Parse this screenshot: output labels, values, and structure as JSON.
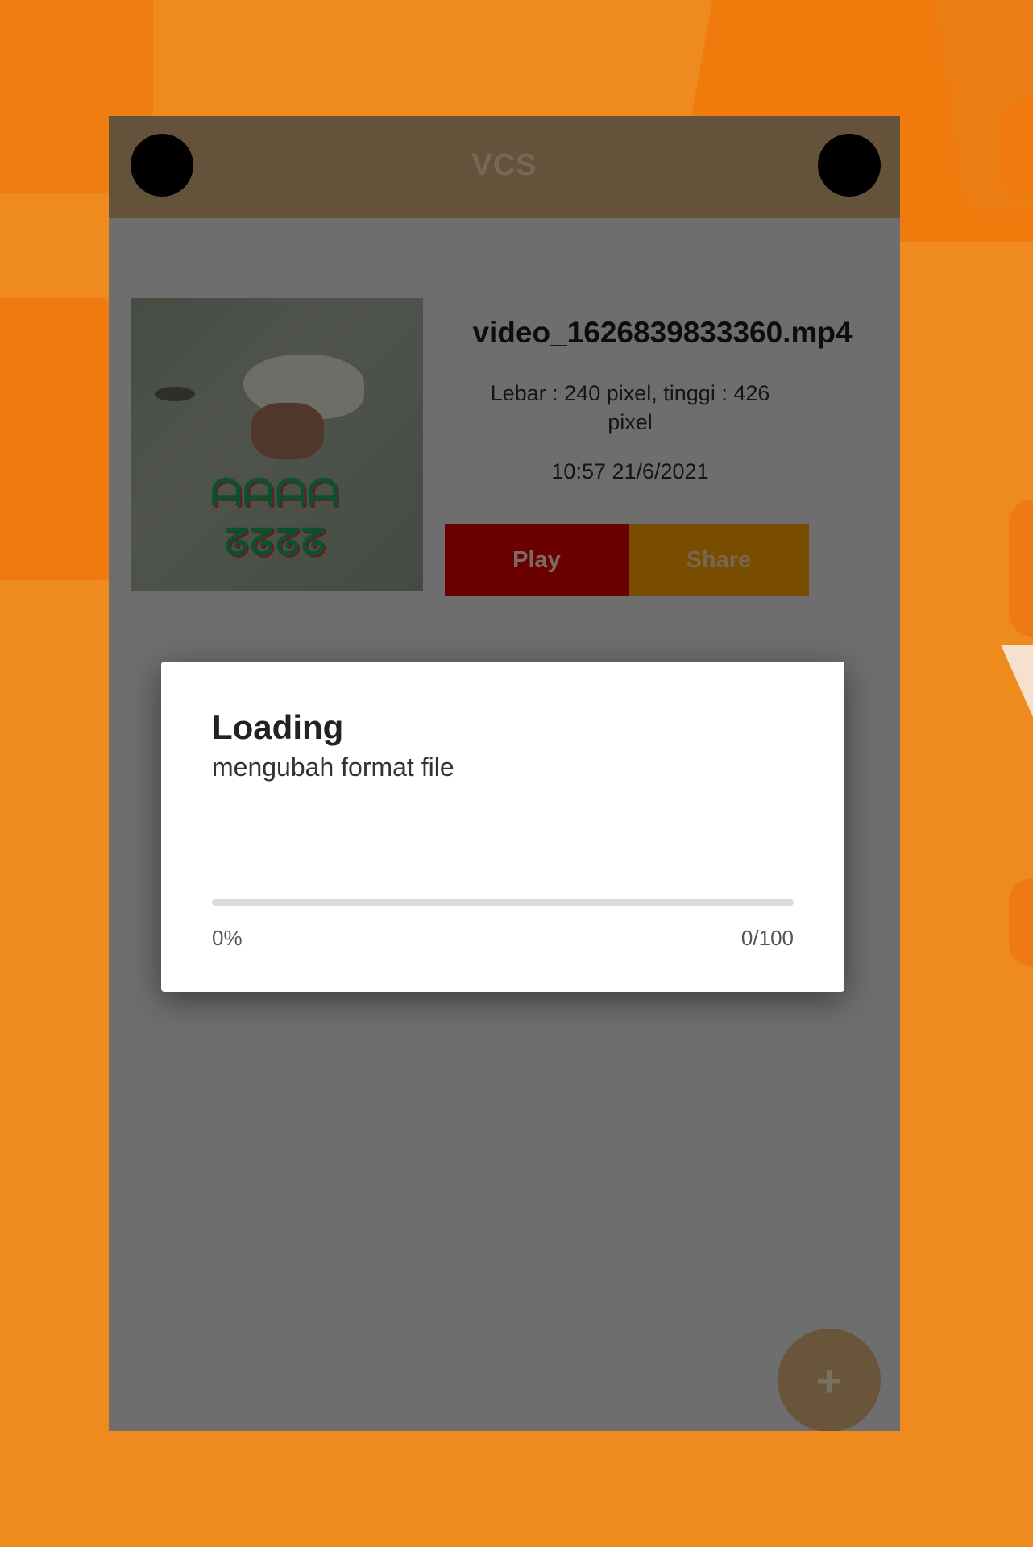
{
  "appbar": {
    "title": "VCS"
  },
  "video": {
    "file_name": "video_1626839833360.mp4",
    "dimensions": "Lebar : 240 pixel, tinggi : 426 pixel",
    "datetime": "10:57 21/6/2021",
    "play_label": "Play",
    "share_label": "Share"
  },
  "fab": {
    "icon": "plus-icon",
    "label": "+"
  },
  "dialog": {
    "title": "Loading",
    "message": "mengubah format file",
    "progress_fraction": 0,
    "percent_text": "0%",
    "count_text": "0/100"
  },
  "colors": {
    "background": "#ef8a1e",
    "appbar": "#c8a574",
    "play": "#d40000",
    "share": "#f09a00"
  }
}
